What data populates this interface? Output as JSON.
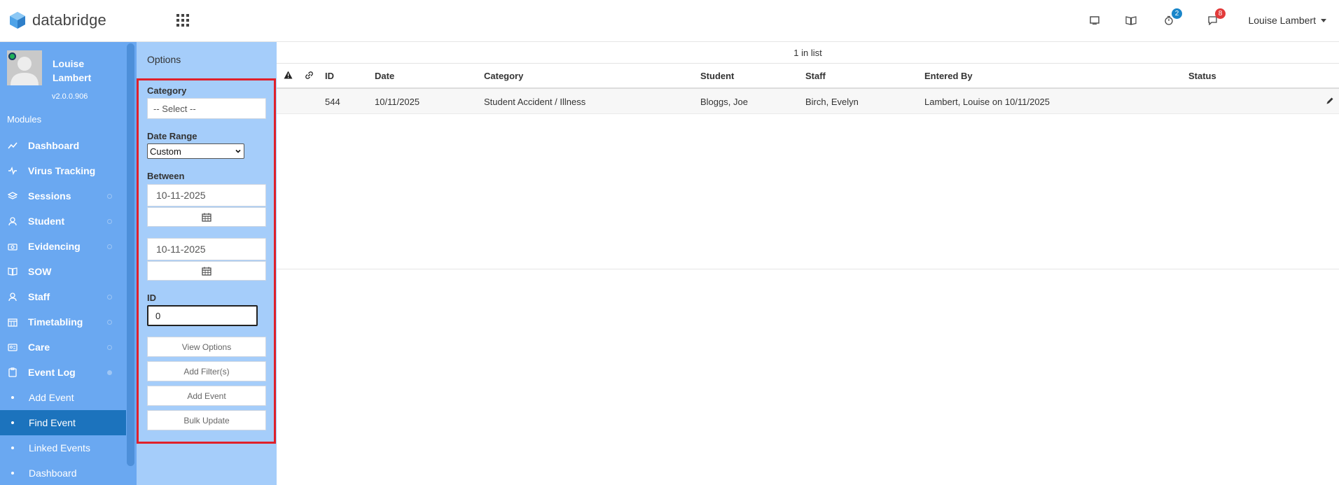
{
  "app": {
    "name": "databridge"
  },
  "header": {
    "badges": {
      "timer": "2",
      "messages": "8"
    },
    "user_name": "Louise Lambert"
  },
  "profile": {
    "name": "Louise Lambert",
    "version": "v2.0.0.906"
  },
  "sidebar": {
    "modules_label": "Modules",
    "items": [
      {
        "label": "Dashboard",
        "icon": "chart-line-icon"
      },
      {
        "label": "Virus Tracking",
        "icon": "pulse-icon"
      },
      {
        "label": "Sessions",
        "icon": "layers-icon"
      },
      {
        "label": "Student",
        "icon": "user-icon"
      },
      {
        "label": "Evidencing",
        "icon": "camera-icon"
      },
      {
        "label": "SOW",
        "icon": "book-icon"
      },
      {
        "label": "Staff",
        "icon": "user-icon"
      },
      {
        "label": "Timetabling",
        "icon": "calendar-icon"
      },
      {
        "label": "Care",
        "icon": "id-card-icon"
      },
      {
        "label": "Event Log",
        "icon": "clipboard-icon"
      }
    ],
    "sub_items": [
      {
        "label": "Add Event"
      },
      {
        "label": "Find Event"
      },
      {
        "label": "Linked Events"
      },
      {
        "label": "Dashboard"
      }
    ]
  },
  "options": {
    "title": "Options",
    "category_label": "Category",
    "category_value": "-- Select --",
    "date_range_label": "Date Range",
    "date_range_value": "Custom",
    "between_label": "Between",
    "date_from": "10-11-2025",
    "date_to": "10-11-2025",
    "id_label": "ID",
    "id_value": "0",
    "buttons": {
      "view_options": "View Options",
      "add_filters": "Add Filter(s)",
      "add_event": "Add Event",
      "bulk_update": "Bulk Update"
    }
  },
  "list": {
    "count_text": "1 in list",
    "columns": {
      "id": "ID",
      "date": "Date",
      "category": "Category",
      "student": "Student",
      "staff": "Staff",
      "entered_by": "Entered By",
      "status": "Status"
    },
    "rows": [
      {
        "id": "544",
        "date": "10/11/2025",
        "category": "Student Accident / Illness",
        "student": "Bloggs, Joe",
        "staff": "Birch, Evelyn",
        "entered_by": "Lambert, Louise on 10/11/2025",
        "status": ""
      }
    ]
  },
  "colors": {
    "sidebar": "#6aa8f1",
    "options_panel": "#a5cdfa",
    "active_item": "#1c73bd",
    "highlight_border": "#e0202a"
  }
}
